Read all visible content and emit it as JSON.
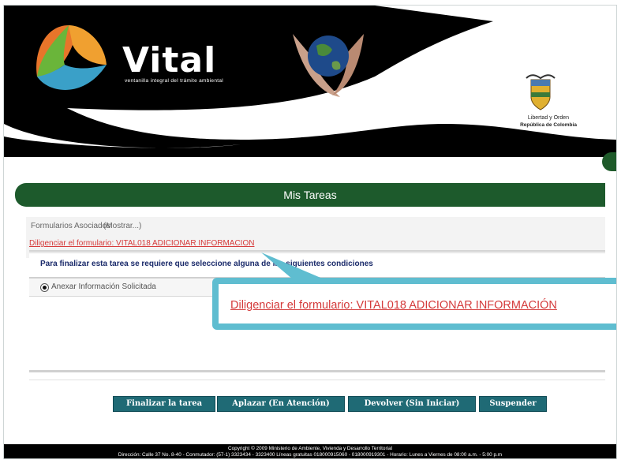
{
  "header": {
    "brand": "Vital",
    "tagline": "ventanilla integral del trámite ambiental",
    "motto_line1": "Libertad y Orden",
    "motto_line2": "República de Colombia"
  },
  "main": {
    "title": "Mis Tareas",
    "forms_label": "Formularios Asociados",
    "show_link": "(Mostrar...)",
    "form_link": "Diligenciar el formulario: VITAL018 ADICIONAR INFORMACION",
    "condition_text": "Para finalizar esta tarea se requiere que seleccione alguna de las siguientes condiciones",
    "radio_label": "Anexar Información Solicitada"
  },
  "callout": {
    "text": "Diligenciar el formulario: VITAL018 ADICIONAR INFORMACIÓN"
  },
  "buttons": {
    "finalizar": "Finalizar la tarea",
    "aplazar": "Aplazar (En Atención)",
    "devolver": "Devolver (Sin Iniciar)",
    "suspender": "Suspender"
  },
  "footer": {
    "line1": "Copyright © 2009 Ministerio de Ambiente, Vivienda y Desarrollo Territorial",
    "line2": "Dirección: Calle 37 No. 8-40 - Conmutador: (57-1) 3323434 - 3323400 Líneas gratuitas 018000915060 - 018000919301 - Horario: Lunes a Viernes de 08:00 a.m. - 5:00 p.m"
  },
  "colors": {
    "title_green": "#1d5a2c",
    "button_teal": "#1f6a75",
    "link_red": "#d63a3a",
    "callout_blue": "#5fbdd0"
  }
}
